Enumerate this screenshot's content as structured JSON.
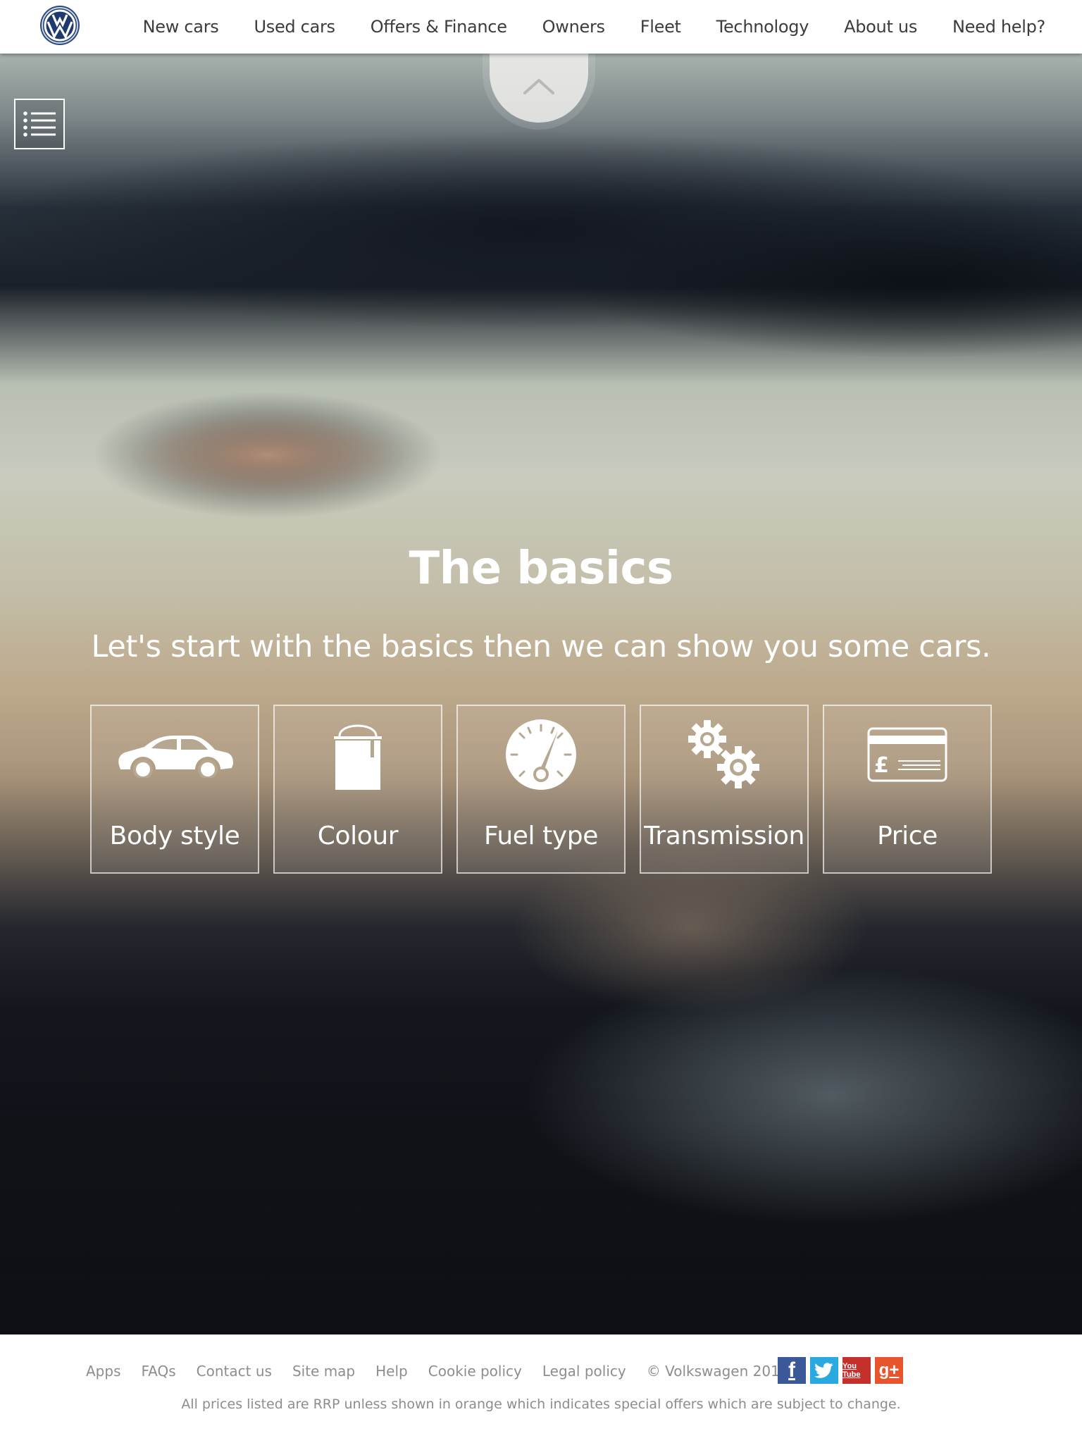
{
  "header": {
    "nav": [
      "New cars",
      "Used cars",
      "Offers & Finance",
      "Owners",
      "Fleet",
      "Technology",
      "About us",
      "Need help?"
    ]
  },
  "icons": {
    "logo": "volkswagen-logo",
    "scroll_up": "chevron-up-icon",
    "menu": "list-menu-icon"
  },
  "hero": {
    "title": "The basics",
    "subtitle": "Let's start with the basics then we can show you some cars.",
    "tiles": [
      {
        "label": "Body style",
        "icon": "car-icon"
      },
      {
        "label": "Colour",
        "icon": "paint-can-icon"
      },
      {
        "label": "Fuel type",
        "icon": "fuel-gauge-icon"
      },
      {
        "label": "Transmission",
        "icon": "gears-icon"
      },
      {
        "label": "Price",
        "icon": "credit-card-icon"
      }
    ]
  },
  "footer": {
    "links": [
      "Apps",
      "FAQs",
      "Contact us",
      "Site map",
      "Help",
      "Cookie policy",
      "Legal policy"
    ],
    "copyright": "© Volkswagen 2016",
    "social": [
      {
        "name": "facebook-icon",
        "glyph": "f",
        "color": "#3b5998"
      },
      {
        "name": "twitter-icon",
        "glyph": "t",
        "color": "#2aa9e0"
      },
      {
        "name": "youtube-icon",
        "glyph": "You Tube",
        "color": "#c4302b"
      },
      {
        "name": "google-plus-icon",
        "glyph": "g+",
        "color": "#e8542b"
      }
    ],
    "disclaimer": "All prices listed are RRP unless shown in orange which indicates special offers which are subject to change."
  },
  "colors": {
    "header_bg": "#ffffff",
    "nav_text": "#3c3c3c",
    "footer_text": "#8d8d8d",
    "vw_blue": "#1e3a6e"
  }
}
